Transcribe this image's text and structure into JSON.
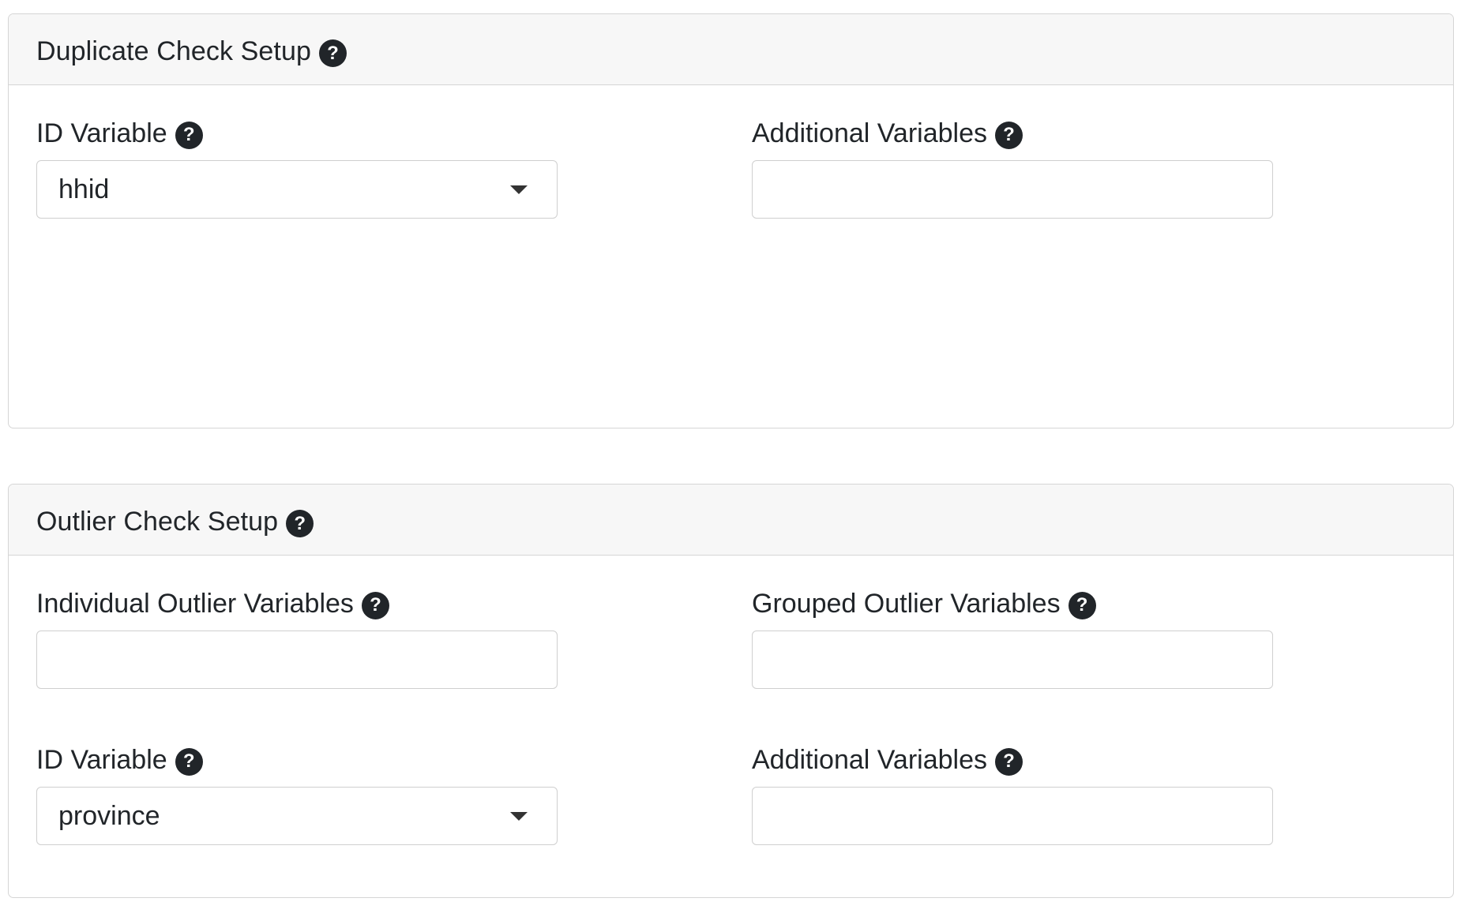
{
  "duplicate_check": {
    "title": "Duplicate Check Setup",
    "id_variable": {
      "label": "ID Variable",
      "value": "hhid"
    },
    "additional_variables": {
      "label": "Additional Variables",
      "value": ""
    }
  },
  "outlier_check": {
    "title": "Outlier Check Setup",
    "individual_outlier_variables": {
      "label": "Individual Outlier Variables",
      "value": ""
    },
    "grouped_outlier_variables": {
      "label": "Grouped Outlier Variables",
      "value": ""
    },
    "id_variable": {
      "label": "ID Variable",
      "value": "province"
    },
    "additional_variables": {
      "label": "Additional Variables",
      "value": ""
    }
  },
  "icons": {
    "help": "?",
    "help_icon_name": "question-circle-icon",
    "dropdown_icon_name": "caret-down-icon"
  },
  "colors": {
    "header_background": "#f7f7f7",
    "border": "#d5d5d5",
    "text": "#212529",
    "help_icon_background": "#212529"
  }
}
